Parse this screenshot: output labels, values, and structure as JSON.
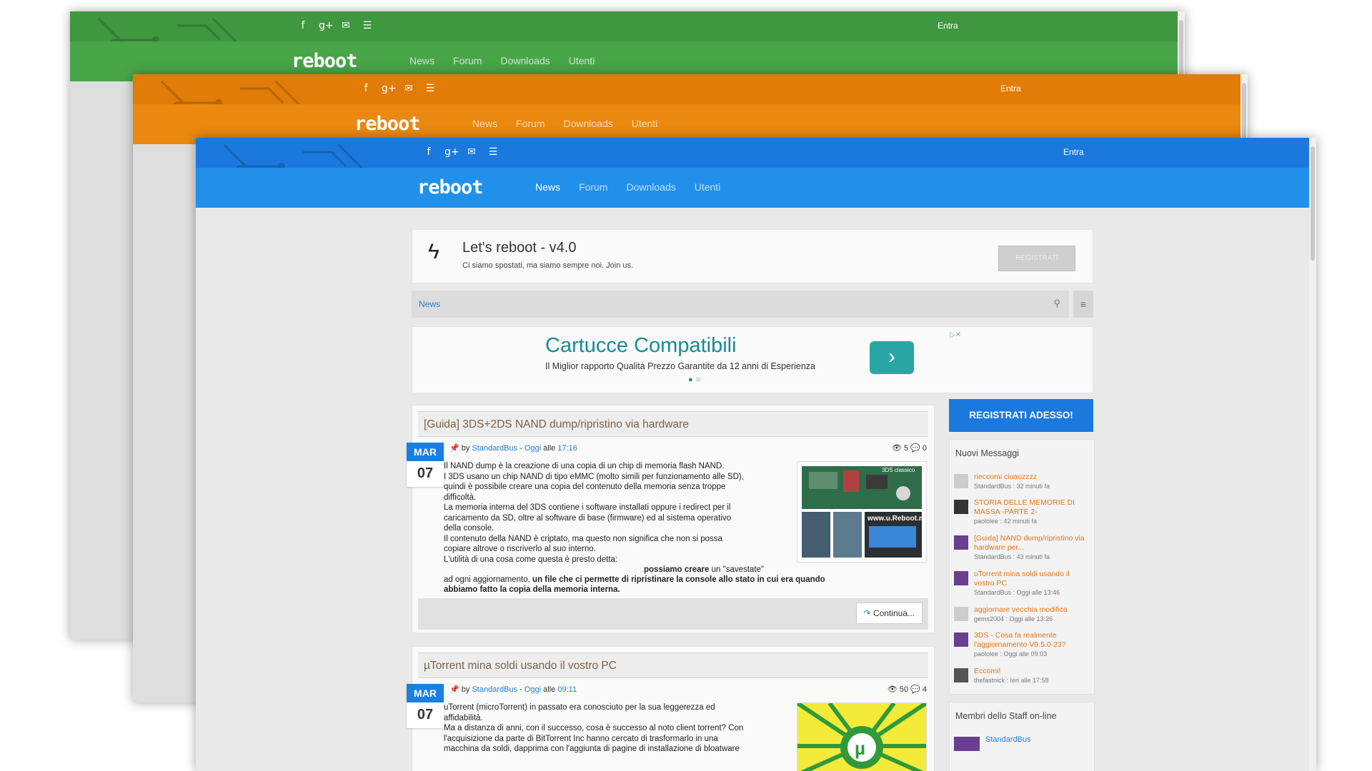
{
  "windows": {
    "green": {
      "social_icons": [
        "facebook-icon",
        "google-plus-icon",
        "mail-icon",
        "rss-icon"
      ],
      "login": "Entra",
      "logo": "reboot",
      "nav": [
        "News",
        "Forum",
        "Downloads",
        "Utenti"
      ],
      "color": "#3f973f"
    },
    "orange": {
      "social_icons": [
        "facebook-icon",
        "google-plus-icon",
        "mail-icon",
        "rss-icon"
      ],
      "login": "Entra",
      "logo": "reboot",
      "nav": [
        "News",
        "Forum",
        "Downloads",
        "Utenti"
      ],
      "color": "#e07c07"
    },
    "blue": {
      "social_icons": [
        "facebook-icon",
        "google-plus-icon",
        "mail-icon",
        "rss-icon"
      ],
      "login": "Entra",
      "logo": "reboot",
      "nav": [
        "News",
        "Forum",
        "Downloads",
        "Utenti"
      ],
      "color": "#1b79de"
    }
  },
  "welcome": {
    "title": "Let's reboot - v4.0",
    "subtitle": "Ci siamo spostati, ma siamo sempre noi. Join us.",
    "register_label": "REGISTRATI"
  },
  "breadcrumb": {
    "label": "News"
  },
  "ad": {
    "title": "Cartucce Compatibili",
    "subtitle": "Il Miglior rapporto Qualità Prezzo Garantite da 12 anni di Esperienza",
    "dots": "●○"
  },
  "posts": [
    {
      "title": "[Guida] 3DS+2DS NAND dump/ripristino via hardware",
      "month": "MAR",
      "day": "07",
      "by": "by",
      "author": "StandardBus",
      "sep": "-",
      "when": "Oggi",
      "at": "alle",
      "time": "17:16",
      "views": "5",
      "comments": "0",
      "body": "Il NAND dump è la creazione di una copia di un chip di memoria flash NAND.\nI 3DS usano un chip NAND di tipo eMMC (molto simili per funzionamento alle SD),\nquindi è possibile creare una copia del contenuto della memoria senza troppe\ndifficoltà.\nLa memoria interna del 3DS contiene i software installati oppure i redirect per il\ncaricamento da SD, oltre al software di base (firmware) ed al sistema operativo\ndella console.\nIl contenuto della NAND è criptato, ma questo non significa che non si possa\ncopiare altrove o riscriverlo al suo interno.\nL'utilità di una cosa come questa è presto detta:",
      "body_bold_a": "possiamo creare",
      "body_mid": "un \"savestate\"",
      "body_line2": "ad ogni aggiornamento,",
      "body_bold_b": "un file che ci permette di ripristinare la console allo stato in cui era quando",
      "body_bold_c": "abbiamo fatto la copia della memoria interna.",
      "img_caption_a": "3DS classico",
      "img_caption_b": "www.u.Reboot.ms",
      "more": "Continua..."
    },
    {
      "title": "µTorrent mina soldi usando il vostro PC",
      "month": "MAR",
      "day": "07",
      "by": "by",
      "author": "StandardBus",
      "sep": "-",
      "when": "Oggi",
      "at": "alle",
      "time": "09:11",
      "views": "50",
      "comments": "4",
      "body": "uTorrent (microTorrent) in passato era conosciuto per la sua leggerezza ed\naffidabilità.\nMa a distanza di anni, con il successo, cosa è successo al noto client torrent? Con\nl'acquisizione da parte di BitTorrent Inc hanno cercato di trasformarlo in una\nmacchina da soldi, dapprima con l'aggiunta di pagine di installazione di bloatware"
    }
  ],
  "sidebar": {
    "register_big": "REGISTRATI ADESSO!",
    "new_messages_title": "Nuovi Messaggi",
    "messages": [
      {
        "title": "rieccomi ciuauzzzz",
        "sub": "StandardBus : 32 minuti fa"
      },
      {
        "title": "STORIA DELLE MEMORIE DI MASSA -PARTE 2-",
        "sub": "paololee : 42 minuti fa"
      },
      {
        "title": "[Guida] NAND dump/ripristino via hardware per...",
        "sub": "StandardBus : 43 minuti fa"
      },
      {
        "title": "uTorrent mina soldi usando il vostro PC",
        "sub": "StandardBus : Oggi alle 13:46"
      },
      {
        "title": "aggiornare vecchia modifica",
        "sub": "gems2004 : Oggi alle 13:26"
      },
      {
        "title": "3DS - Cosa fa realmente l'aggiornamento V9.5.0-23?",
        "sub": "paololee : Oggi alle 09:03"
      },
      {
        "title": "Eccomi!",
        "sub": "thefastnick : Ieri alle 17:58"
      }
    ],
    "staff_title": "Membri dello Staff on-line",
    "staff_member": "StandardBus"
  }
}
